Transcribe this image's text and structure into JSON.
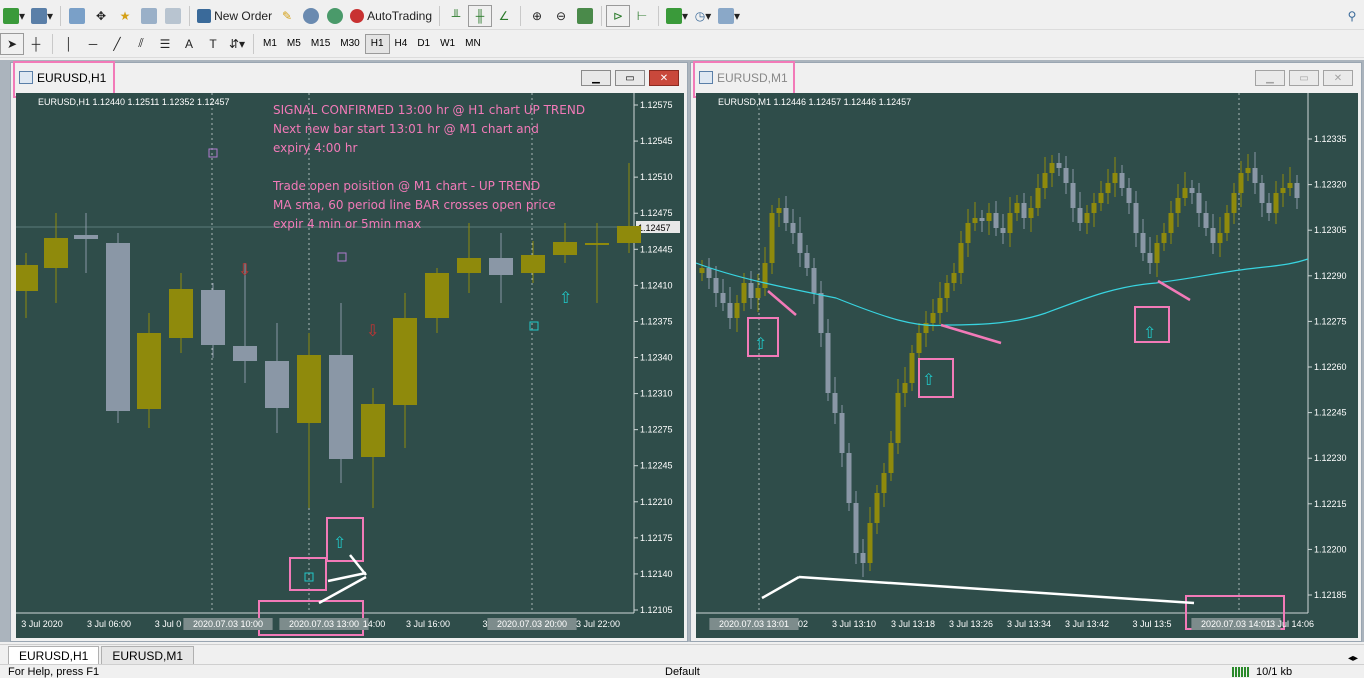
{
  "toolbar": {
    "new_order_label": "New Order",
    "autotrading_label": "AutoTrading",
    "timeframes": [
      "M1",
      "M5",
      "M15",
      "M30",
      "H1",
      "H4",
      "D1",
      "W1",
      "MN"
    ],
    "active_timeframe": "H1"
  },
  "window_h1": {
    "title": "EURUSD,H1",
    "info": "EURUSD,H1  1.12440 1.12511 1.12352 1.12457",
    "price_label": "1.12457",
    "yticks": [
      "1.12575",
      "1.12545",
      "1.12510",
      "1.12475",
      "1.12445",
      "1.12410",
      "1.12375",
      "1.12340",
      "1.12310",
      "1.12275",
      "1.12245",
      "1.12210",
      "1.12175",
      "1.12140",
      "1.12105"
    ],
    "xticks": [
      "3 Jul 2020",
      "3 Jul 06:00",
      "3 Jul 0",
      "2020.07.03 10:00",
      "2020.07.03 13:00",
      "14:00",
      "3 Jul 16:00",
      "3 Jul",
      "2020.07.03 20:00",
      "3 Jul 22:00"
    ],
    "note_lines": [
      "SIGNAL CONFIRMED 13:00 hr @ H1 chart UP TREND",
      "Next new bar start 13:01 hr @ M1 chart  and",
      "expiry 4:00 hr",
      "",
      "Trade open poisition @ M1 chart - UP TREND",
      "MA sma, 60 period line BAR crosses open price",
      "expir 4 min or 5min max"
    ]
  },
  "window_m1": {
    "title": "EURUSD,M1",
    "info": "EURUSD,M1  1.12446 1.12457 1.12446 1.12457",
    "yticks": [
      "1.12335",
      "1.12320",
      "1.12305",
      "1.12290",
      "1.12275",
      "1.12260",
      "1.12245",
      "1.12230",
      "1.12215",
      "1.12200",
      "1.12185"
    ],
    "xticks": [
      "2020.07.03 13:01",
      "02",
      "3 Jul 13:10",
      "3 Jul 13:18",
      "3 Jul 13:26",
      "3 Jul 13:34",
      "3 Jul 13:42",
      "3 Jul 13:5",
      "2020.07.03 14:01",
      "3 Jul 14:06"
    ]
  },
  "tabs": [
    "EURUSD,H1",
    "EURUSD,M1"
  ],
  "status": {
    "help": "For Help, press F1",
    "profile": "Default",
    "traffic": "10/1 kb"
  },
  "colors": {
    "chart_bg": "#2f4d4a",
    "bull": "#8f8a0c",
    "bear": "#8a97a6",
    "ma": "#38d4e0",
    "annotation": "#f27ab8"
  }
}
